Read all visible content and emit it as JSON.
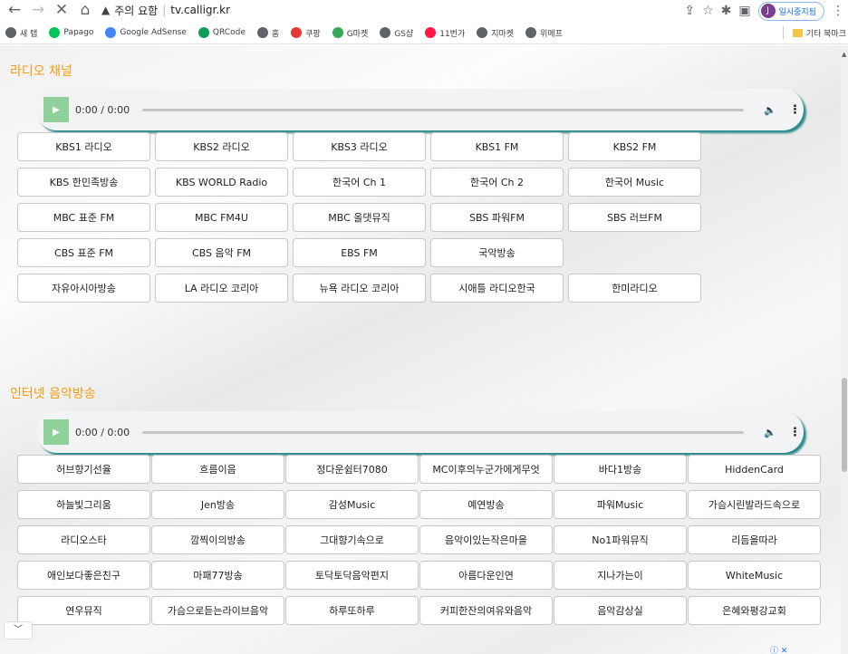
{
  "browser": {
    "security_label": "주의 요함",
    "url": "tv.calligr.kr",
    "profile_label": "일시중지됨",
    "profile_initial": "J"
  },
  "bookmarks": [
    {
      "label": "새 탭",
      "icon": "globe-icon",
      "color": "#5f6368"
    },
    {
      "label": "Papago",
      "icon": "papago-icon",
      "color": "#03c75a"
    },
    {
      "label": "Google AdSense",
      "icon": "google-icon",
      "color": "#4285f4"
    },
    {
      "label": "QRCode",
      "icon": "qrcode-icon",
      "color": "#0f9d58"
    },
    {
      "label": "홈",
      "icon": "globe-icon",
      "color": "#5f6368"
    },
    {
      "label": "쿠팡",
      "icon": "coupang-icon",
      "color": "#e53935"
    },
    {
      "label": "G마켓",
      "icon": "google-icon",
      "color": "#34a853"
    },
    {
      "label": "GS샵",
      "icon": "globe-icon",
      "color": "#5f6368"
    },
    {
      "label": "11번가",
      "icon": "11st-icon",
      "color": "#ff1744"
    },
    {
      "label": "지마켓",
      "icon": "globe-icon",
      "color": "#5f6368"
    },
    {
      "label": "위메프",
      "icon": "globe-icon",
      "color": "#5f6368"
    }
  ],
  "other_bookmarks": "기타 북마크",
  "radio": {
    "title": "라디오 채널",
    "player_time": "0:00 / 0:00",
    "buttons": [
      "KBS1 라디오",
      "KBS2 라디오",
      "KBS3 라디오",
      "KBS1 FM",
      "KBS2 FM",
      "KBS 한민족방송",
      "KBS WORLD Radio",
      "한국어 Ch 1",
      "한국어 Ch 2",
      "한국어 Music",
      "MBC 표준 FM",
      "MBC FM4U",
      "MBC 올댓뮤직",
      "SBS 파워FM",
      "SBS 러브FM",
      "CBS 표준 FM",
      "CBS 음악 FM",
      "EBS FM",
      "국악방송",
      "",
      "자유아시아방송",
      "LA 라디오 코리아",
      "뉴욕 라디오 코리아",
      "시애틀 라디오한국",
      "한미라디오"
    ]
  },
  "internet": {
    "title": "인터넷 음악방송",
    "player_time": "0:00 / 0:00",
    "buttons": [
      "허브향기선율",
      "흐름이음",
      "정다운쉼터7080",
      "MC이후의누군가에게무엇",
      "바다1방송",
      "HiddenCard",
      "하늘빛그리움",
      "Jen방송",
      "감성Music",
      "예연방송",
      "파워Music",
      "가슴시린발라드속으로",
      "라디오스타",
      "깜찍이의방송",
      "그대향기속으로",
      "음악이있는작은마을",
      "No1파워뮤직",
      "리듬을따라",
      "애인보다좋은친구",
      "마패77방송",
      "토닥토닥음악편지",
      "아름다운인연",
      "지나가는이",
      "WhiteMusic",
      "연우뮤직",
      "가슴으로듣는라이브음악",
      "하루또하루",
      "커피한잔의여유와음악",
      "음악감상실",
      "은혜와평강교회"
    ]
  },
  "ad_info": "ⓘ ✕"
}
